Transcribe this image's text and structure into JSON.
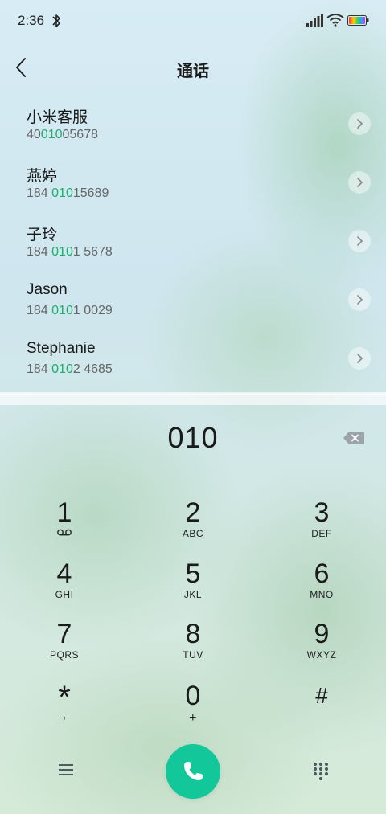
{
  "status_bar": {
    "time": "2:36",
    "icons": [
      "bluetooth-icon",
      "signal-icon",
      "wifi-icon",
      "battery-icon"
    ]
  },
  "header": {
    "back_icon": "chevron-left-icon",
    "title": "通话"
  },
  "contacts": [
    {
      "name": "小米客服",
      "number_pre": "40",
      "number_match": "010",
      "number_post": "05678"
    },
    {
      "name": "燕婷",
      "number_pre": "184 ",
      "number_match": "010",
      "number_post": "15689"
    },
    {
      "name": "子玲",
      "number_pre": "184 ",
      "number_match": "010",
      "number_post": "1 5678"
    },
    {
      "name": "Jason",
      "number_pre": "184 ",
      "number_match": "010",
      "number_post": "1 0029"
    },
    {
      "name": "Stephanie",
      "number_pre": "184 ",
      "number_match": "010",
      "number_post": "2 4685"
    }
  ],
  "dial": {
    "input": "010",
    "backspace_icon": "backspace-icon"
  },
  "keypad": [
    {
      "digit": "1",
      "letters": ""
    },
    {
      "digit": "2",
      "letters": "ABC"
    },
    {
      "digit": "3",
      "letters": "DEF"
    },
    {
      "digit": "4",
      "letters": "GHI"
    },
    {
      "digit": "5",
      "letters": "JKL"
    },
    {
      "digit": "6",
      "letters": "MNO"
    },
    {
      "digit": "7",
      "letters": "PQRS"
    },
    {
      "digit": "8",
      "letters": "TUV"
    },
    {
      "digit": "9",
      "letters": "WXYZ"
    },
    {
      "digit": "*",
      "letters": ","
    },
    {
      "digit": "0",
      "letters": "+"
    },
    {
      "digit": "#",
      "letters": ""
    }
  ],
  "bottom_bar": {
    "menu_icon": "menu-icon",
    "call_icon": "phone-icon",
    "keypad_icon": "dialpad-icon"
  },
  "colors": {
    "accent_green": "#1fae6b",
    "call_button": "#12c79a"
  }
}
